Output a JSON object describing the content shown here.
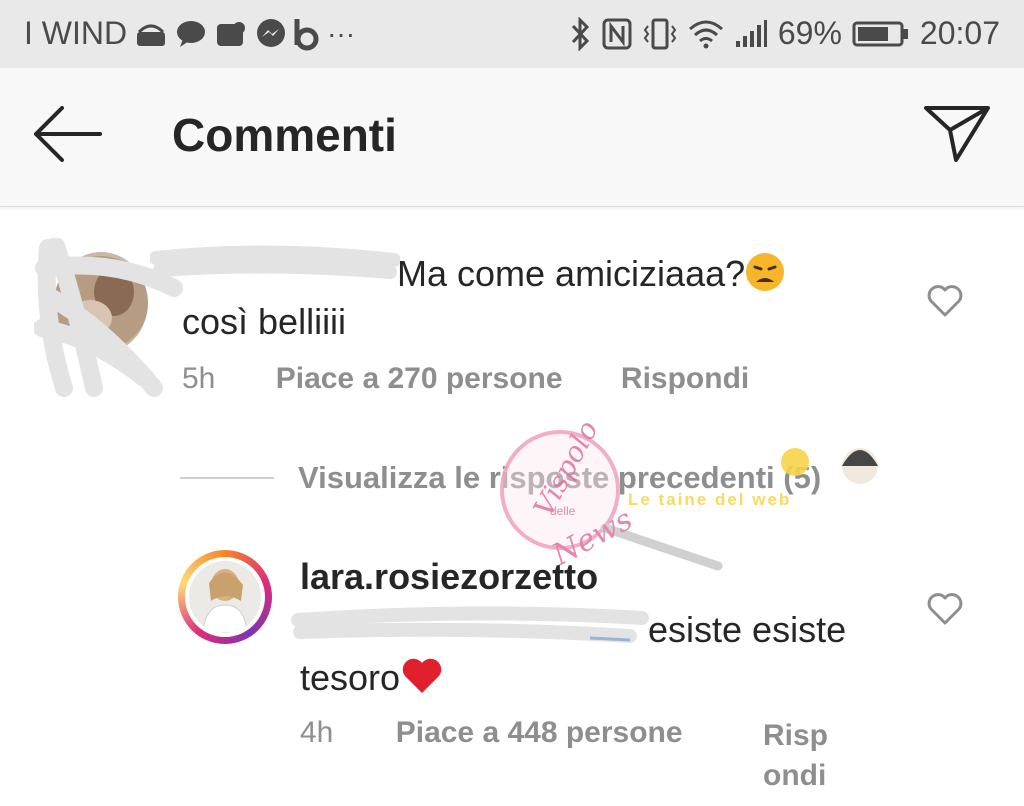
{
  "status_bar": {
    "carrier": "I WIND",
    "more": "···",
    "battery": "69%",
    "time": "20:07"
  },
  "header": {
    "title": "Commenti"
  },
  "comment1": {
    "text_part": "Ma come amiciziaaa?",
    "text_line2": "così belliiii",
    "time": "5h",
    "likes": "Piace a 270 persone",
    "reply": "Rispondi"
  },
  "view_previous": {
    "label": "Visualizza le risposte precedenti (5)"
  },
  "comment2": {
    "username": "lara.rosiezorzetto",
    "text_part": "esiste esiste",
    "text_line2": "tesoro",
    "time": "4h",
    "likes": "Piace a 448 persone",
    "reply": "Rispondi"
  },
  "watermark": {
    "line1": "Vispolo",
    "line2": "delle",
    "line3": "News",
    "line4": "Le taine del web"
  },
  "colors": {
    "text": "#262626",
    "muted": "#8e8e8e",
    "status_bg": "#e9e9e9",
    "header_bg": "#f8f8f8",
    "heart_red": "#e0202c"
  }
}
